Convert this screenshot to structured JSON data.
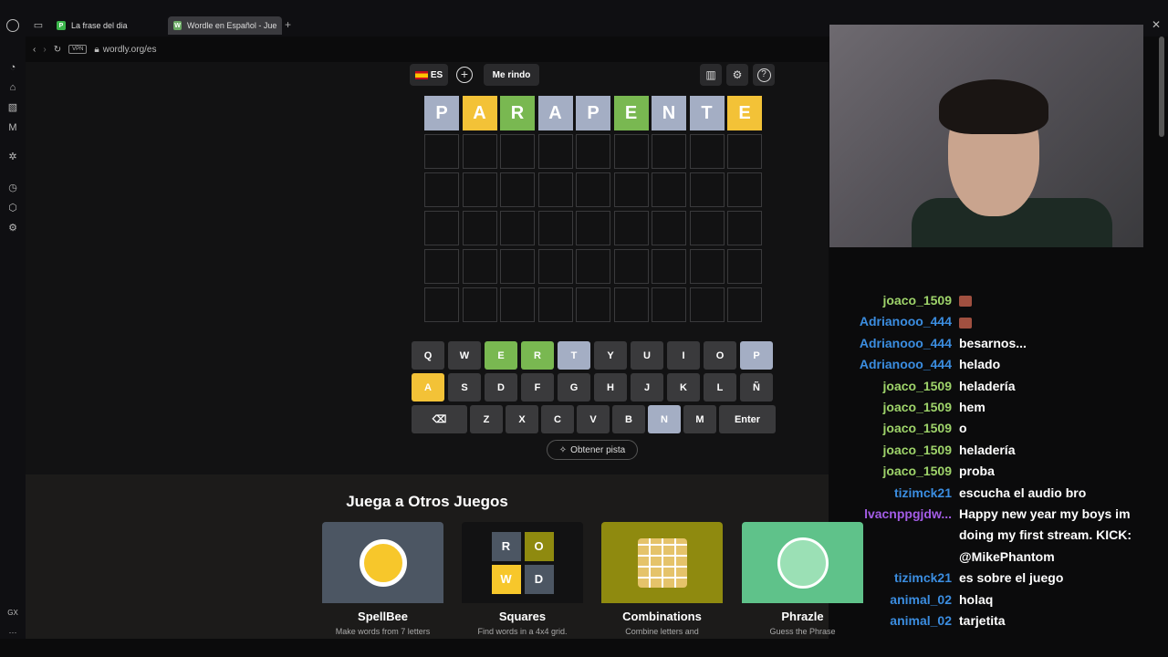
{
  "browser": {
    "tabs": [
      {
        "label": "La frase del dia",
        "favicon": "P",
        "favicon_color": "#3ab54a"
      },
      {
        "label": "Wordle en Español - Juego",
        "favicon": "W",
        "favicon_color": "#6aaa64"
      }
    ],
    "url": "wordly.org/es",
    "vpn_label": "VPN",
    "new_tab": "+",
    "close": "✕"
  },
  "sidebar": {
    "bottom_label": "GX",
    "more_label": "···"
  },
  "game": {
    "lang_label": "ES",
    "giveup_label": "Me rindo",
    "colors": {
      "correct": "#79b851",
      "present": "#f3c237",
      "absent": "#a4aec4",
      "empty": "#121213",
      "key": "#3a3a3c"
    },
    "board": [
      [
        {
          "l": "P",
          "s": "absent"
        },
        {
          "l": "A",
          "s": "present"
        },
        {
          "l": "R",
          "s": "correct"
        },
        {
          "l": "A",
          "s": "absent"
        },
        {
          "l": "P",
          "s": "absent"
        },
        {
          "l": "E",
          "s": "correct"
        },
        {
          "l": "N",
          "s": "absent"
        },
        {
          "l": "T",
          "s": "absent"
        },
        {
          "l": "E",
          "s": "present"
        }
      ],
      [],
      [],
      [],
      [],
      []
    ],
    "keyboard": [
      [
        {
          "l": "Q"
        },
        {
          "l": "W"
        },
        {
          "l": "E",
          "s": "correct"
        },
        {
          "l": "R",
          "s": "correct"
        },
        {
          "l": "T",
          "s": "absent"
        },
        {
          "l": "Y"
        },
        {
          "l": "U"
        },
        {
          "l": "I"
        },
        {
          "l": "O"
        },
        {
          "l": "P",
          "s": "absent"
        }
      ],
      [
        {
          "l": "A",
          "s": "present"
        },
        {
          "l": "S"
        },
        {
          "l": "D"
        },
        {
          "l": "F"
        },
        {
          "l": "G"
        },
        {
          "l": "H"
        },
        {
          "l": "J"
        },
        {
          "l": "K"
        },
        {
          "l": "L"
        },
        {
          "l": "Ñ"
        }
      ],
      [
        {
          "l": "⌫",
          "t": "backspace"
        },
        {
          "l": "Z"
        },
        {
          "l": "X"
        },
        {
          "l": "C"
        },
        {
          "l": "V"
        },
        {
          "l": "B"
        },
        {
          "l": "N",
          "s": "absent"
        },
        {
          "l": "M"
        },
        {
          "l": "Enter",
          "t": "enter"
        }
      ]
    ],
    "hint_label": "Obtener pista"
  },
  "other_games": {
    "title": "Juega a Otros Juegos",
    "cards": [
      {
        "name": "SpellBee",
        "desc": "Make words from 7 letters",
        "bg": "#4c5663"
      },
      {
        "name": "Squares",
        "desc": "Find words in a 4x4 grid.",
        "bg": "#121213"
      },
      {
        "name": "Combinations",
        "desc": "Combine letters and",
        "bg": "#8f8a0f"
      },
      {
        "name": "Phrazle",
        "desc": "Guess the Phrase",
        "bg": "#5fc28a"
      }
    ],
    "squares_letters": [
      "R",
      "O",
      "W",
      "D"
    ]
  },
  "chat": [
    {
      "user": "joaco_1509",
      "color": "#9ed36a",
      "text": "",
      "emote": true
    },
    {
      "user": "Adrianooo_444",
      "color": "#3b8de0",
      "text": "",
      "emote": true
    },
    {
      "user": "Adrianooo_444",
      "color": "#3b8de0",
      "text": "besarnos..."
    },
    {
      "user": "Adrianooo_444",
      "color": "#3b8de0",
      "text": "helado"
    },
    {
      "user": "joaco_1509",
      "color": "#9ed36a",
      "text": "heladería"
    },
    {
      "user": "joaco_1509",
      "color": "#9ed36a",
      "text": "hem"
    },
    {
      "user": "joaco_1509",
      "color": "#9ed36a",
      "text": "o"
    },
    {
      "user": "joaco_1509",
      "color": "#9ed36a",
      "text": "heladería"
    },
    {
      "user": "joaco_1509",
      "color": "#9ed36a",
      "text": "proba"
    },
    {
      "user": "tizimck21",
      "color": "#3b8de0",
      "text": "escucha el audio bro"
    },
    {
      "user": "lvacnppgjdw...",
      "color": "#a35ce6",
      "text": "Happy new year my boys im doing my first stream. KICK: @MikePhantom"
    },
    {
      "user": "tizimck21",
      "color": "#3b8de0",
      "text": "es sobre el juego"
    },
    {
      "user": "animal_02",
      "color": "#3b8de0",
      "text": "holaq"
    },
    {
      "user": "animal_02",
      "color": "#3b8de0",
      "text": "tarjetita"
    }
  ]
}
